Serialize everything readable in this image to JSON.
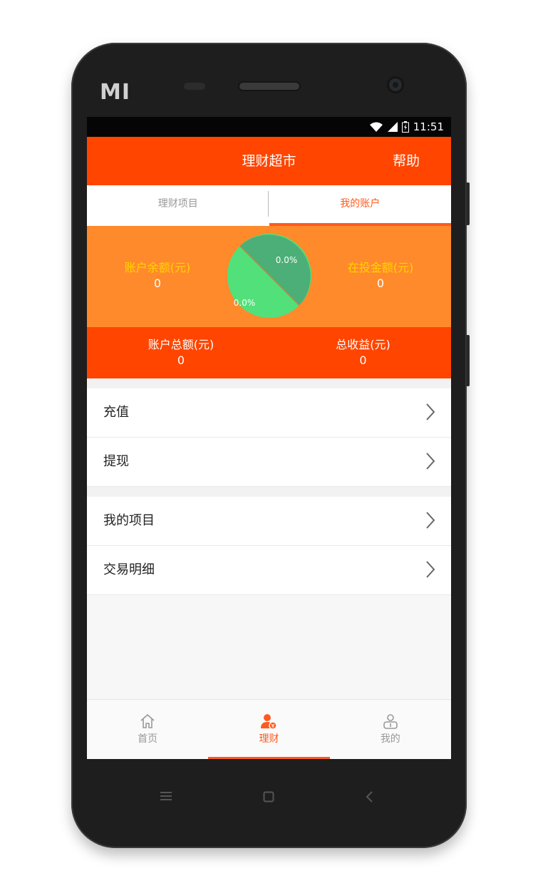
{
  "device": {
    "brand": "MI"
  },
  "statusbar": {
    "time": "11:51",
    "icons": [
      "wifi-icon",
      "signal-icon",
      "battery-icon"
    ]
  },
  "appbar": {
    "title": "理财超市",
    "help": "帮助"
  },
  "tabs": [
    {
      "label": "理财项目",
      "active": false
    },
    {
      "label": "我的账户",
      "active": true
    }
  ],
  "summary": {
    "balance": {
      "label": "账户余额(元)",
      "value": "0"
    },
    "invested": {
      "label": "在投金额(元)",
      "value": "0"
    },
    "total": {
      "label": "账户总额(元)",
      "value": "0"
    },
    "earnings": {
      "label": "总收益(元)",
      "value": "0"
    },
    "pie": {
      "slices": [
        {
          "label": "0.0%",
          "value": 0.5,
          "color": "#4caf78"
        },
        {
          "label": "0.0%",
          "value": 0.5,
          "color": "#52e07a"
        }
      ]
    }
  },
  "menu_group_1": [
    {
      "label": "充值"
    },
    {
      "label": "提现"
    }
  ],
  "menu_group_2": [
    {
      "label": "我的项目"
    },
    {
      "label": "交易明细"
    }
  ],
  "bottom_nav": [
    {
      "label": "首页",
      "icon": "home-icon",
      "active": false
    },
    {
      "label": "理财",
      "icon": "finance-user-icon",
      "active": true
    },
    {
      "label": "我的",
      "icon": "profile-icon",
      "active": false
    }
  ],
  "colors": {
    "primary": "#ff4500",
    "summary_bg": "#ff8a2b",
    "accent_text": "#ffd500",
    "active_tab": "#ff5a1f"
  }
}
